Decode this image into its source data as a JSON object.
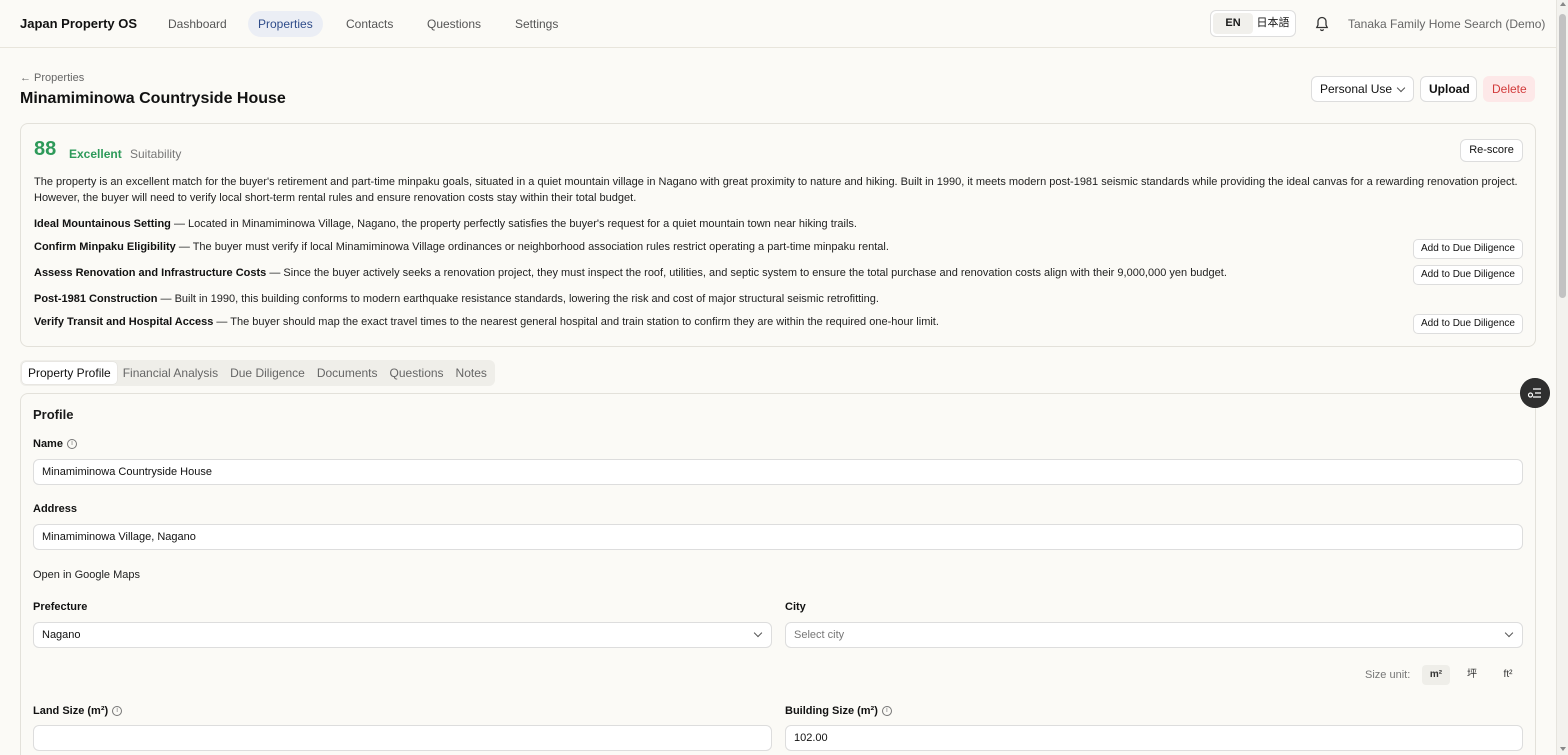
{
  "app": {
    "brand": "Japan Property OS",
    "nav": [
      "Dashboard",
      "Properties",
      "Contacts",
      "Questions",
      "Settings"
    ],
    "active_nav": "Properties",
    "lang": {
      "en": "EN",
      "ja": "日本語"
    },
    "account": "Tanaka Family Home Search (Demo)"
  },
  "header": {
    "back": "← Properties",
    "title": "Minamiminowa Countryside House",
    "use_select": "Personal Use",
    "upload": "Upload",
    "delete": "Delete"
  },
  "score": {
    "value": "88",
    "label": "Excellent",
    "kind": "Suitability",
    "rescore": "Re-score",
    "summary": "The property is an excellent match for the buyer's retirement and part-time minpaku goals, situated in a quiet mountain village in Nagano with great proximity to nature and hiking. Built in 1990, it meets modern post-1981 seismic standards while providing the ideal canvas for a rewarding renovation project. However, the buyer will need to verify local short-term rental rules and ensure renovation costs stay within their total budget.",
    "findings": [
      {
        "title": "Ideal Mountainous Setting",
        "text": " — Located in Minamiminowa Village, Nagano, the property perfectly satisfies the buyer's request for a quiet mountain town near hiking trails."
      },
      {
        "title": "Confirm Minpaku Eligibility",
        "text": " — The buyer must verify if local Minamiminowa Village ordinances or neighborhood association rules restrict operating a part-time minpaku rental.",
        "action": "Add to Due Diligence"
      },
      {
        "title": "Assess Renovation and Infrastructure Costs",
        "text": " — Since the buyer actively seeks a renovation project, they must inspect the roof, utilities, and septic system to ensure the total purchase and renovation costs align with their 9,000,000 yen budget.",
        "action": "Add to Due Diligence"
      },
      {
        "title": "Post-1981 Construction",
        "text": " — Built in 1990, this building conforms to modern earthquake resistance standards, lowering the risk and cost of major structural seismic retrofitting."
      },
      {
        "title": "Verify Transit and Hospital Access",
        "text": " — The buyer should map the exact travel times to the nearest general hospital and train station to confirm they are within the required one-hour limit.",
        "action": "Add to Due Diligence"
      }
    ]
  },
  "tabs": [
    "Property Profile",
    "Financial Analysis",
    "Due Diligence",
    "Documents",
    "Questions",
    "Notes"
  ],
  "profile": {
    "section": "Profile",
    "name_label": "Name",
    "name_value": "Minamiminowa Countryside House",
    "address_label": "Address",
    "address_value": "Minamiminowa Village, Nagano",
    "maps_link": "Open in Google Maps",
    "prefecture_label": "Prefecture",
    "prefecture_value": "Nagano",
    "city_label": "City",
    "city_placeholder": "Select city",
    "size_unit_label": "Size unit:",
    "size_units": [
      "m²",
      "坪",
      "ft²"
    ],
    "land_size_label": "Land Size (m²)",
    "land_size_value": "",
    "building_size_label": "Building Size (m²)",
    "building_size_value": "102.00"
  }
}
